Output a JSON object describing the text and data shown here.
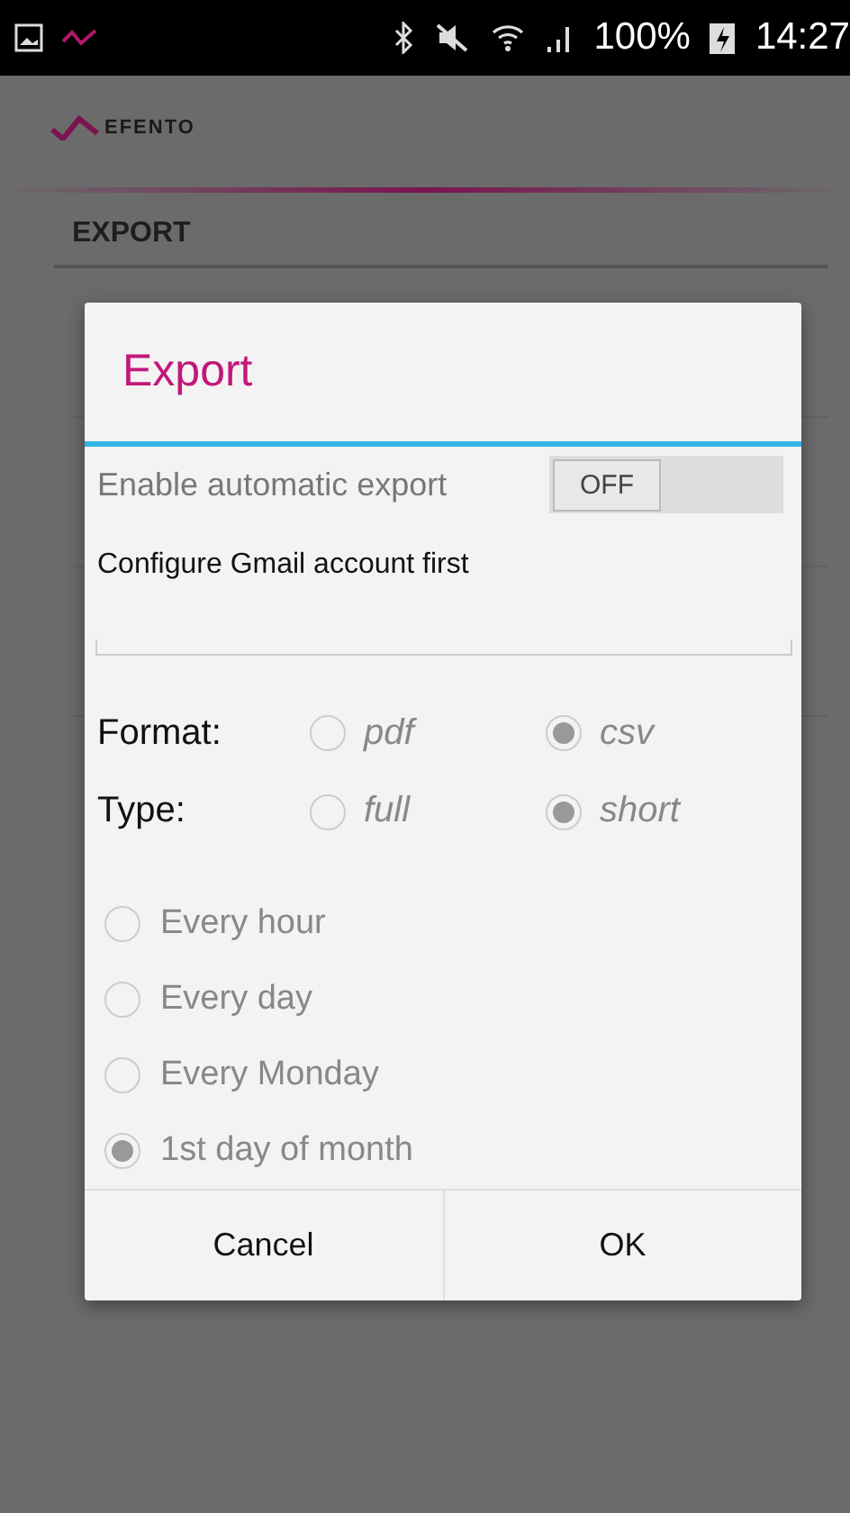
{
  "status_bar": {
    "battery": "100%",
    "time": "14:27"
  },
  "app_bar": {
    "logo": "EFENTO"
  },
  "section": "EXPORT",
  "dialog": {
    "title": "Export",
    "auto_export": {
      "label": "Enable automatic export",
      "toggle": "OFF",
      "on": false
    },
    "message": "Configure Gmail account first",
    "options": [
      {
        "label": "Format:",
        "choices": [
          {
            "label": "pdf",
            "selected": false
          },
          {
            "label": "csv",
            "selected": true
          }
        ]
      },
      {
        "label": "Type:",
        "choices": [
          {
            "label": "full",
            "selected": false
          },
          {
            "label": "short",
            "selected": true
          }
        ]
      }
    ],
    "frequency": [
      {
        "label": "Every hour",
        "selected": false
      },
      {
        "label": "Every day",
        "selected": false
      },
      {
        "label": "Every Monday",
        "selected": false
      },
      {
        "label": "1st day of month",
        "selected": true
      }
    ],
    "buttons": [
      "Cancel",
      "OK"
    ]
  }
}
